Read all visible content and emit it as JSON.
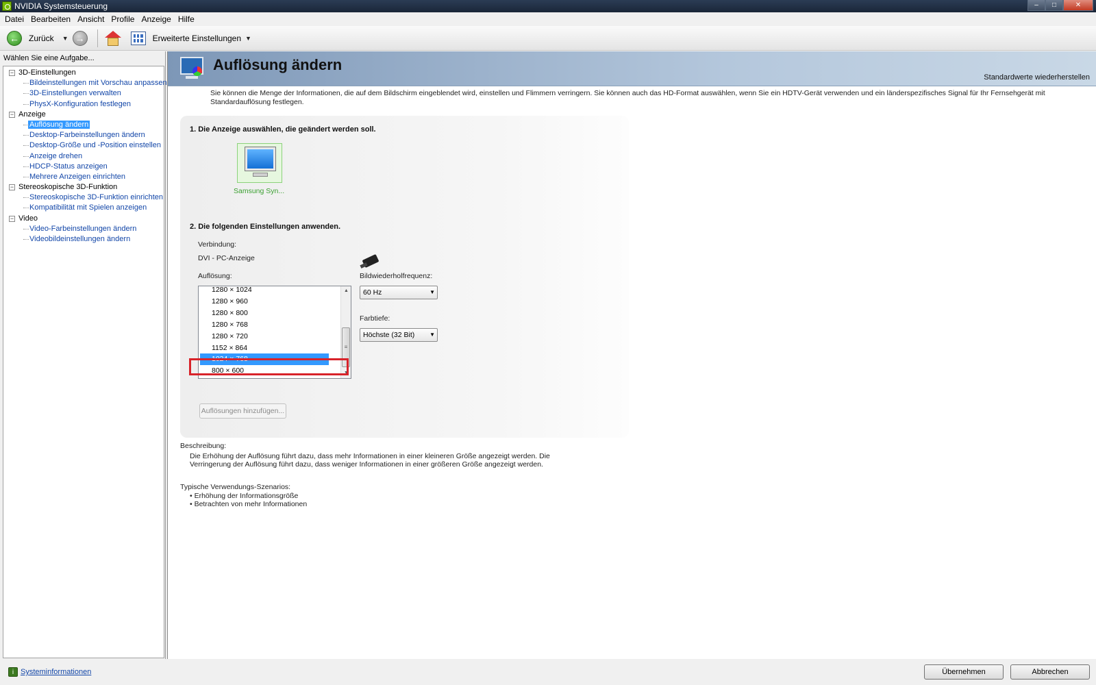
{
  "window": {
    "title": "NVIDIA Systemsteuerung",
    "btn_min": "–",
    "btn_max": "□",
    "btn_close": "✕"
  },
  "menu": [
    "Datei",
    "Bearbeiten",
    "Ansicht",
    "Profile",
    "Anzeige",
    "Hilfe"
  ],
  "toolbar": {
    "back_label": "Zurück",
    "advanced_label": "Erweiterte Einstellungen",
    "back_icon": "←",
    "forward_icon": "→",
    "arrow": "▼"
  },
  "sidebar": {
    "header": "Wählen Sie eine Aufgabe...",
    "expander": "−",
    "categories": [
      {
        "label": "3D-Einstellungen",
        "items": [
          "Bildeinstellungen mit Vorschau anpassen",
          "3D-Einstellungen verwalten",
          "PhysX-Konfiguration festlegen"
        ]
      },
      {
        "label": "Anzeige",
        "items": [
          "Auflösung ändern",
          "Desktop-Farbeinstellungen ändern",
          "Desktop-Größe und -Position einstellen",
          "Anzeige drehen",
          "HDCP-Status anzeigen",
          "Mehrere Anzeigen einrichten"
        ]
      },
      {
        "label": "Stereoskopische 3D-Funktion",
        "items": [
          "Stereoskopische 3D-Funktion einrichten",
          "Kompatibilität mit Spielen anzeigen"
        ]
      },
      {
        "label": "Video",
        "items": [
          "Video-Farbeinstellungen ändern",
          "Videobildeinstellungen ändern"
        ]
      }
    ],
    "selected_item": "Auflösung ändern",
    "sysinfo_label": "Systeminformationen",
    "sysinfo_icon": "i"
  },
  "page": {
    "title": "Auflösung ändern",
    "restore_label": "Standardwerte wiederherstellen",
    "intro": "Sie können die Menge der Informationen, die auf dem Bildschirm eingeblendet wird, einstellen und Flimmern verringern. Sie können auch das HD-Format auswählen, wenn Sie ein HDTV-Gerät verwenden und ein länderspezifisches Signal für Ihr Fernsehgerät mit Standardauflösung festlegen.",
    "step1": "1. Die Anzeige auswählen, die geändert werden soll.",
    "display_name": "Samsung Syn...",
    "step2": "2. Die folgenden Einstellungen anwenden.",
    "connection_label": "Verbindung:",
    "connection_value": "DVI - PC-Anzeige",
    "resolution_label": "Auflösung:",
    "resolutions": [
      "1280 × 1024",
      "1280 × 960",
      "1280 × 800",
      "1280 × 768",
      "1280 × 720",
      "1152 × 864",
      "1024 × 768",
      "800 × 600"
    ],
    "selected_resolution": "1024 × 768",
    "scroll_up": "▲",
    "scroll_down": "▼",
    "scroll_grip": "≡",
    "refresh_label": "Bildwiederholfrequenz:",
    "refresh_value": "60 Hz",
    "depth_label": "Farbtiefe:",
    "depth_value": "Höchste (32 Bit)",
    "combo_arrow": "▼",
    "add_resolutions_label": "Auflösungen hinzufügen...",
    "description_heading": "Beschreibung:",
    "description_line1": "Die Erhöhung der Auflösung führt dazu, dass mehr Informationen in einer kleineren Größe angezeigt werden. Die",
    "description_line2": "Verringerung der Auflösung führt dazu, dass weniger Informationen in einer größeren Größe angezeigt werden.",
    "scenarios_heading": "Typische Verwendungs-Szenarios:",
    "scenarios": [
      "• Erhöhung der Informationsgröße",
      "• Betrachten von mehr Informationen"
    ]
  },
  "footer": {
    "apply_label": "Übernehmen",
    "cancel_label": "Abbrechen"
  },
  "colors": {
    "selection": "#3399ff",
    "link": "#1246a8",
    "highlight_frame": "#d8232a",
    "nvidia_green": "#76b900"
  }
}
